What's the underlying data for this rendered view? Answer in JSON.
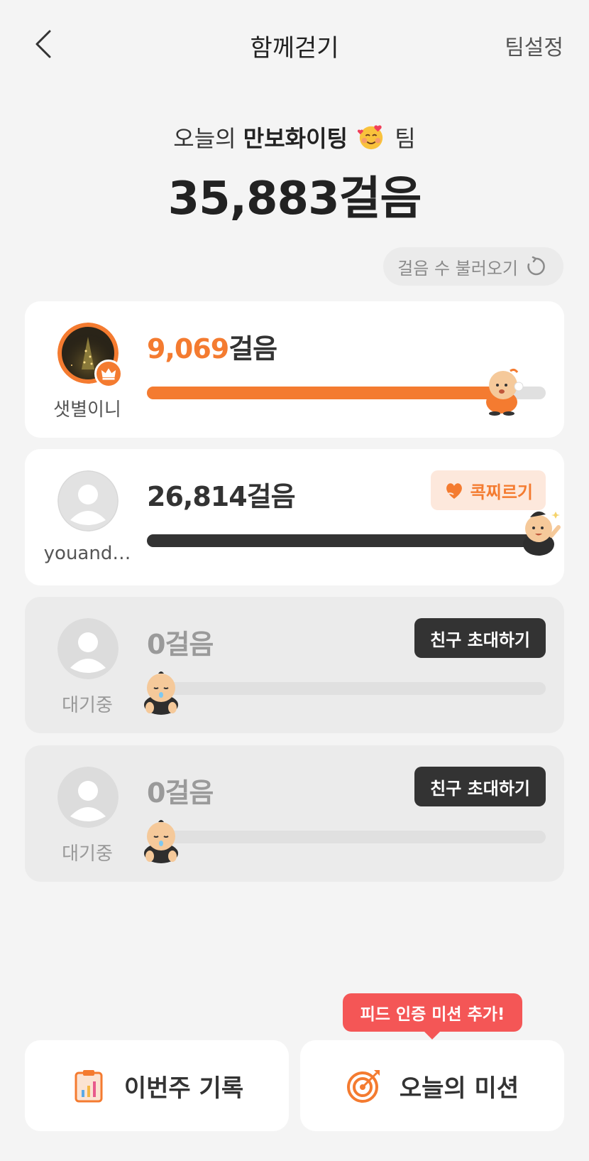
{
  "header": {
    "title": "함께걷기",
    "settings_label": "팀설정"
  },
  "team": {
    "prefix": "오늘의",
    "name": "만보화이팅",
    "suffix": "팀",
    "total_steps": "35,883걸음"
  },
  "reload": {
    "label": "걸음 수 불러오기"
  },
  "members": [
    {
      "name": "샛별이니",
      "steps_number": "9,069",
      "steps_unit": "걸음",
      "progress": 0.9
    },
    {
      "name": "youand…",
      "steps": "26,814걸음",
      "poke_label": "콕찌르기",
      "progress": 1.0
    },
    {
      "name": "대기중",
      "steps": "0걸음",
      "invite_label": "친구 초대하기",
      "progress": 0
    },
    {
      "name": "대기중",
      "steps": "0걸음",
      "invite_label": "친구 초대하기",
      "progress": 0
    }
  ],
  "tooltip": {
    "text": "피드 인증 미션 추가!"
  },
  "bottom": {
    "weekly_label": "이번주 기록",
    "mission_label": "오늘의 미션"
  },
  "colors": {
    "accent": "#f47b30",
    "dark": "#333333",
    "tooltip": "#f45656",
    "background": "#f4f4f4"
  }
}
